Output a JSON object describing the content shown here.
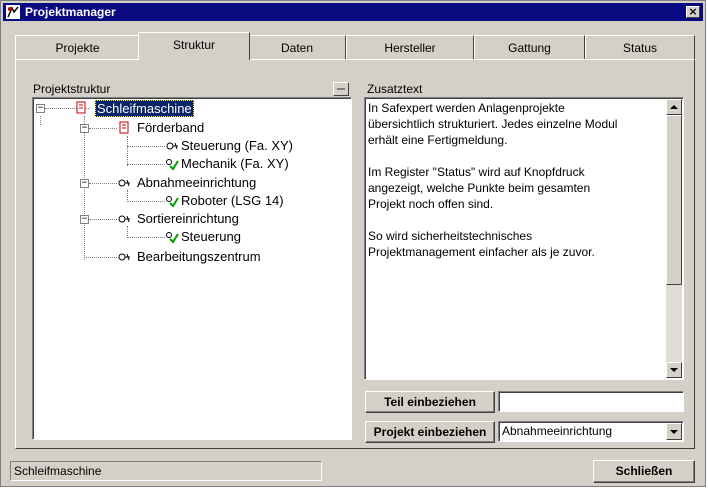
{
  "window": {
    "title": "Projektmanager",
    "close_glyph": "×"
  },
  "tabs": [
    {
      "label": "Projekte"
    },
    {
      "label": "Struktur"
    },
    {
      "label": "Daten"
    },
    {
      "label": "Hersteller"
    },
    {
      "label": "Gattung"
    },
    {
      "label": "Status"
    }
  ],
  "active_tab": "Struktur",
  "structure": {
    "label": "Projektstruktur",
    "tree": [
      {
        "label": "Schleifmaschine",
        "icon": "project-icon",
        "selected": true
      },
      {
        "label": "Förderband",
        "icon": "project-icon"
      },
      {
        "label": "Steuerung (Fa. XY)",
        "icon": "component-icon"
      },
      {
        "label": "Mechanik (Fa. XY)",
        "icon": "component-checked-icon"
      },
      {
        "label": "Abnahmeeinrichtung",
        "icon": "component-icon"
      },
      {
        "label": "Roboter (LSG 14)",
        "icon": "component-checked-icon"
      },
      {
        "label": "Sortiereinrichtung",
        "icon": "component-icon"
      },
      {
        "label": "Steuerung",
        "icon": "component-checked-icon"
      },
      {
        "label": "Bearbeitungszentrum",
        "icon": "component-icon"
      }
    ]
  },
  "zusatztext": {
    "label": "Zusatztext",
    "text": "In Safexpert werden Anlagenprojekte\nübersichtlich strukturiert. Jedes einzelne Modul\nerhält eine Fertigmeldung.\n\nIm Register \"Status\" wird auf Knopfdruck\nangezeigt, welche Punkte beim gesamten\nProjekt noch offen sind.\n\nSo wird sicherheitstechnisches\nProjektmanagement einfacher als je zuvor."
  },
  "actions": {
    "teil_label": "Teil einbeziehen",
    "teil_value": "",
    "projekt_label": "Projekt einbeziehen",
    "projekt_select_value": "Abnahmeeinrichtung"
  },
  "footer": {
    "status_text": "Schleifmaschine",
    "close_label": "Schließen"
  },
  "colors": {
    "titlebar": "#0a0a80",
    "selection": "#0a246a",
    "check": "#00a000",
    "face": "#d4d0c8"
  }
}
